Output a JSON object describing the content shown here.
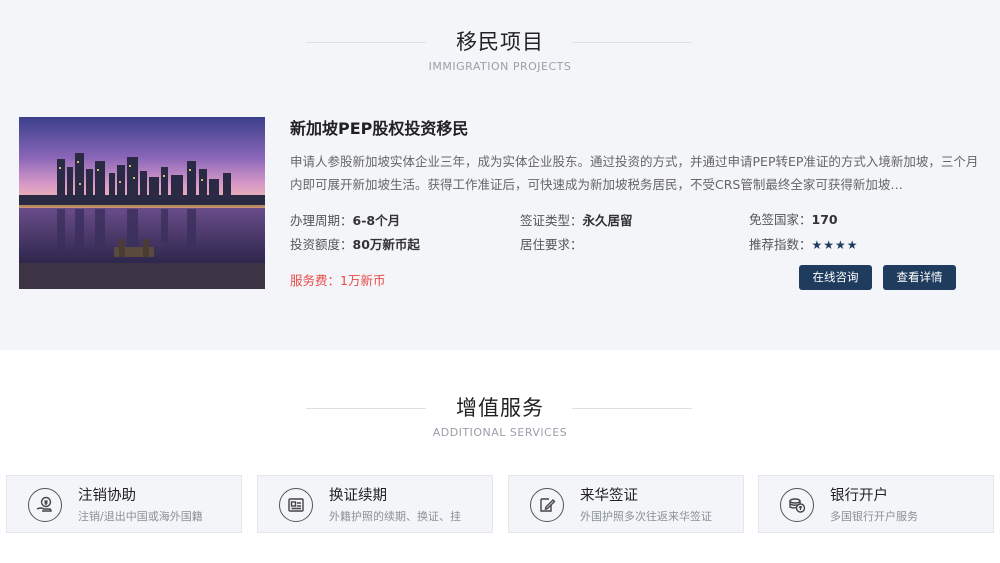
{
  "projects_section": {
    "title": "移民项目",
    "subtitle": "IMMIGRATION PROJECTS"
  },
  "project": {
    "title": "新加坡PEP股权投资移民",
    "description": "申请人参股新加坡实体企业三年，成为实体企业股东。通过投资的方式，并通过申请PEP转EP准证的方式入境新加坡，三个月内即可展开新加坡生活。获得工作准证后，可快速成为新加坡税务居民，不受CRS管制最终全家可获得新加坡…",
    "processing_label": "办理周期：",
    "processing_value": "6-8个月",
    "visa_label": "签证类型：",
    "visa_value": "永久居留",
    "visa_free_label": "免签国家：",
    "visa_free_value": "170",
    "investment_label": "投资额度：",
    "investment_value": "80万新币起",
    "residence_label": "居住要求：",
    "residence_value": "",
    "rating_label": "推荐指数：",
    "rating_stars": "★★★★",
    "rating_value": 4,
    "fee_text": "服务费：1万新币",
    "consult_button": "在线咨询",
    "details_button": "查看详情"
  },
  "services_section": {
    "title": "增值服务",
    "subtitle": "ADDITIONAL SERVICES"
  },
  "services": [
    {
      "title": "注销协助",
      "desc": "注销/退出中国或海外国籍",
      "icon": "hand-money-icon"
    },
    {
      "title": "换证续期",
      "desc": "外籍护照的续期、换证、挂",
      "icon": "id-card-icon"
    },
    {
      "title": "来华签证",
      "desc": "外国护照多次往返来华签证",
      "icon": "edit-document-icon"
    },
    {
      "title": "银行开户",
      "desc": "多国银行开户服务",
      "icon": "coins-icon"
    }
  ],
  "colors": {
    "accent": "#1f3c5e",
    "fee": "#e84a4a",
    "section_bg": "#f3f5f8"
  }
}
